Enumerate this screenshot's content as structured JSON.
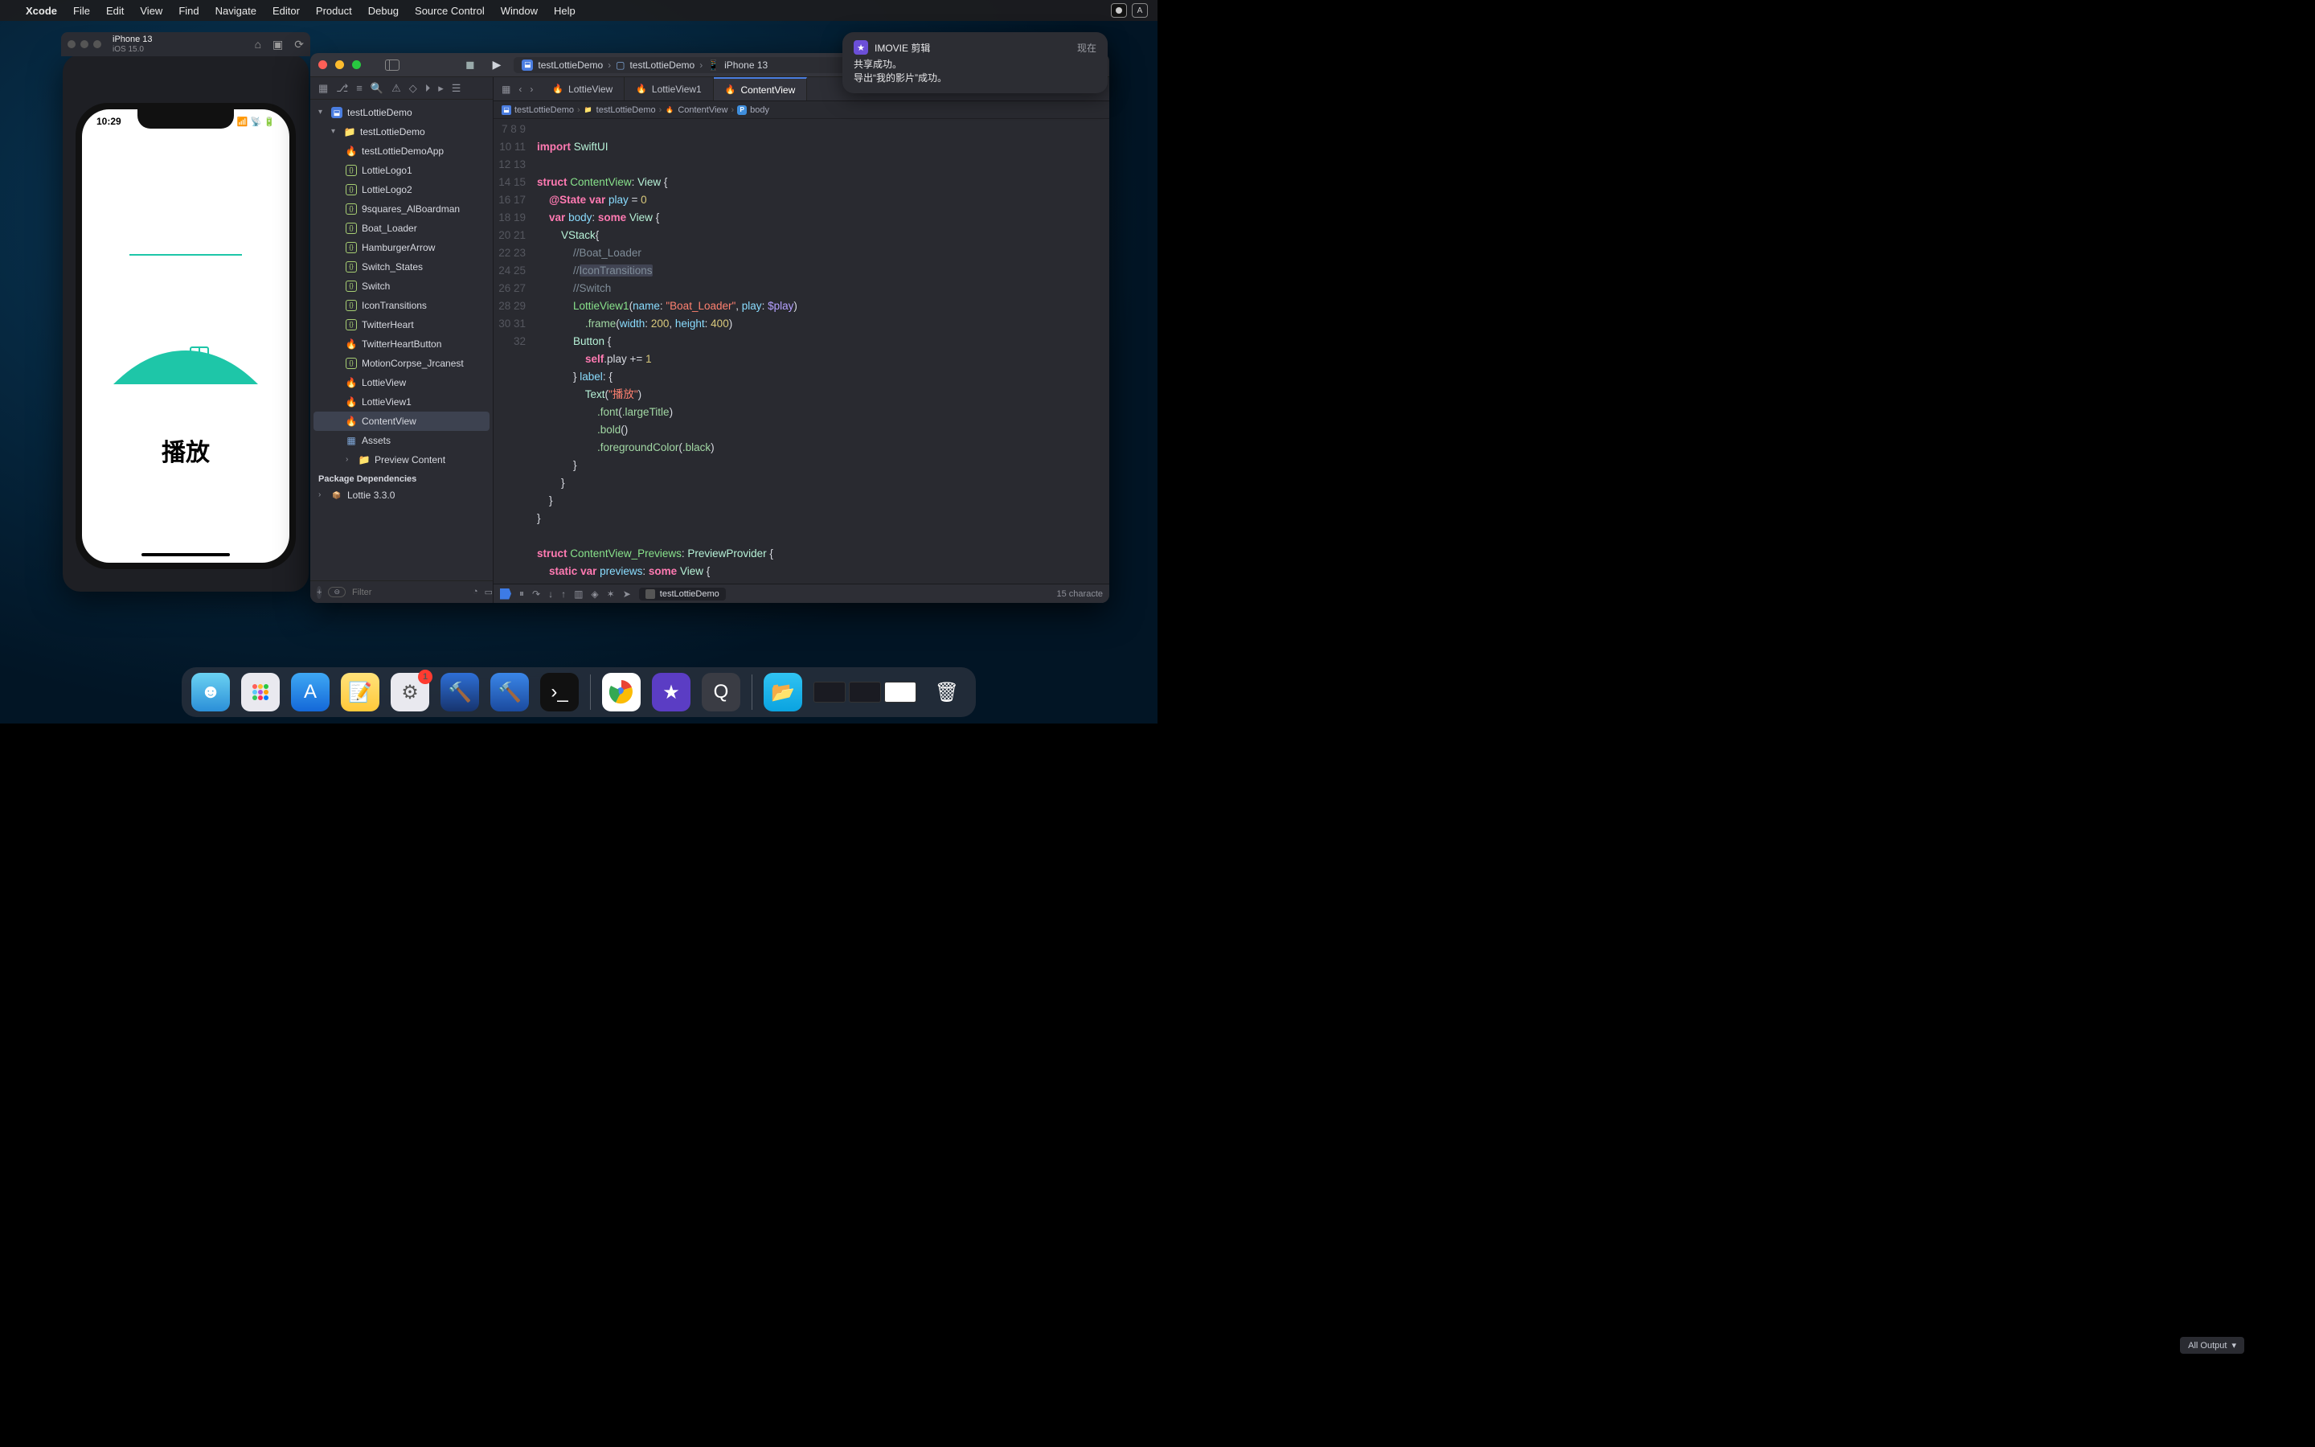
{
  "menubar": {
    "app": "Xcode",
    "items": [
      "File",
      "Edit",
      "View",
      "Find",
      "Navigate",
      "Editor",
      "Product",
      "Debug",
      "Source Control",
      "Window",
      "Help"
    ],
    "input_badge": "A"
  },
  "simulator": {
    "device": "iPhone 13",
    "os": "iOS 15.0",
    "clock": "10:29",
    "play_button": "播放"
  },
  "scheme": {
    "project": "testLottieDemo",
    "target_group": "testLottieDemo",
    "device": "iPhone 13"
  },
  "navigator": {
    "project": "testLottieDemo",
    "group": "testLottieDemo",
    "files": [
      "testLottieDemoApp",
      "LottieLogo1",
      "LottieLogo2",
      "9squares_AlBoardman",
      "Boat_Loader",
      "HamburgerArrow",
      "Switch_States",
      "Switch",
      "IconTransitions",
      "TwitterHeart",
      "TwitterHeartButton",
      "MotionCorpse_Jrcanest",
      "LottieView",
      "LottieView1",
      "ContentView"
    ],
    "assets": "Assets",
    "preview": "Preview Content",
    "deps_header": "Package Dependencies",
    "dep": "Lottie 3.3.0",
    "filter_placeholder": "Filter"
  },
  "tabs": {
    "t1": "LottieView",
    "t2": "LottieView1",
    "t3": "ContentView"
  },
  "jumpbar": {
    "p1": "testLottieDemo",
    "p2": "testLottieDemo",
    "p3": "ContentView",
    "p4": "body"
  },
  "code": {
    "line_start": 7,
    "lines": [
      "",
      "import SwiftUI",
      "",
      "struct ContentView: View {",
      "    @State var play = 0",
      "    var body: some View {",
      "        VStack{",
      "            //Boat_Loader",
      "            //IconTransitions",
      "            //Switch",
      "            LottieView1(name: \"Boat_Loader\", play: $play)",
      "                .frame(width: 200, height: 400)",
      "            Button {",
      "                self.play += 1",
      "            } label: {",
      "                Text(\"播放\")",
      "                    .font(.largeTitle)",
      "                    .bold()",
      "                    .foregroundColor(.black)",
      "            }",
      "        }",
      "    }",
      "}",
      "",
      "struct ContentView_Previews: PreviewProvider {",
      "    static var previews: some View {"
    ],
    "selected_comment": "IconTransitions"
  },
  "debug": {
    "exe": "testLottieDemo",
    "status": "15 characte",
    "output_label": "All Output"
  },
  "notification": {
    "app": "IMOVIE 剪辑",
    "when": "现在",
    "line1": "共享成功。",
    "line2": "导出“我的影片”成功。"
  },
  "dock": {
    "apps": [
      "finder",
      "launchpad",
      "appstore",
      "notes",
      "settings",
      "xcode-beta",
      "xcode",
      "terminal"
    ],
    "apps2": [
      "chrome",
      "imovie",
      "quicktime"
    ],
    "settings_badge": "1"
  }
}
